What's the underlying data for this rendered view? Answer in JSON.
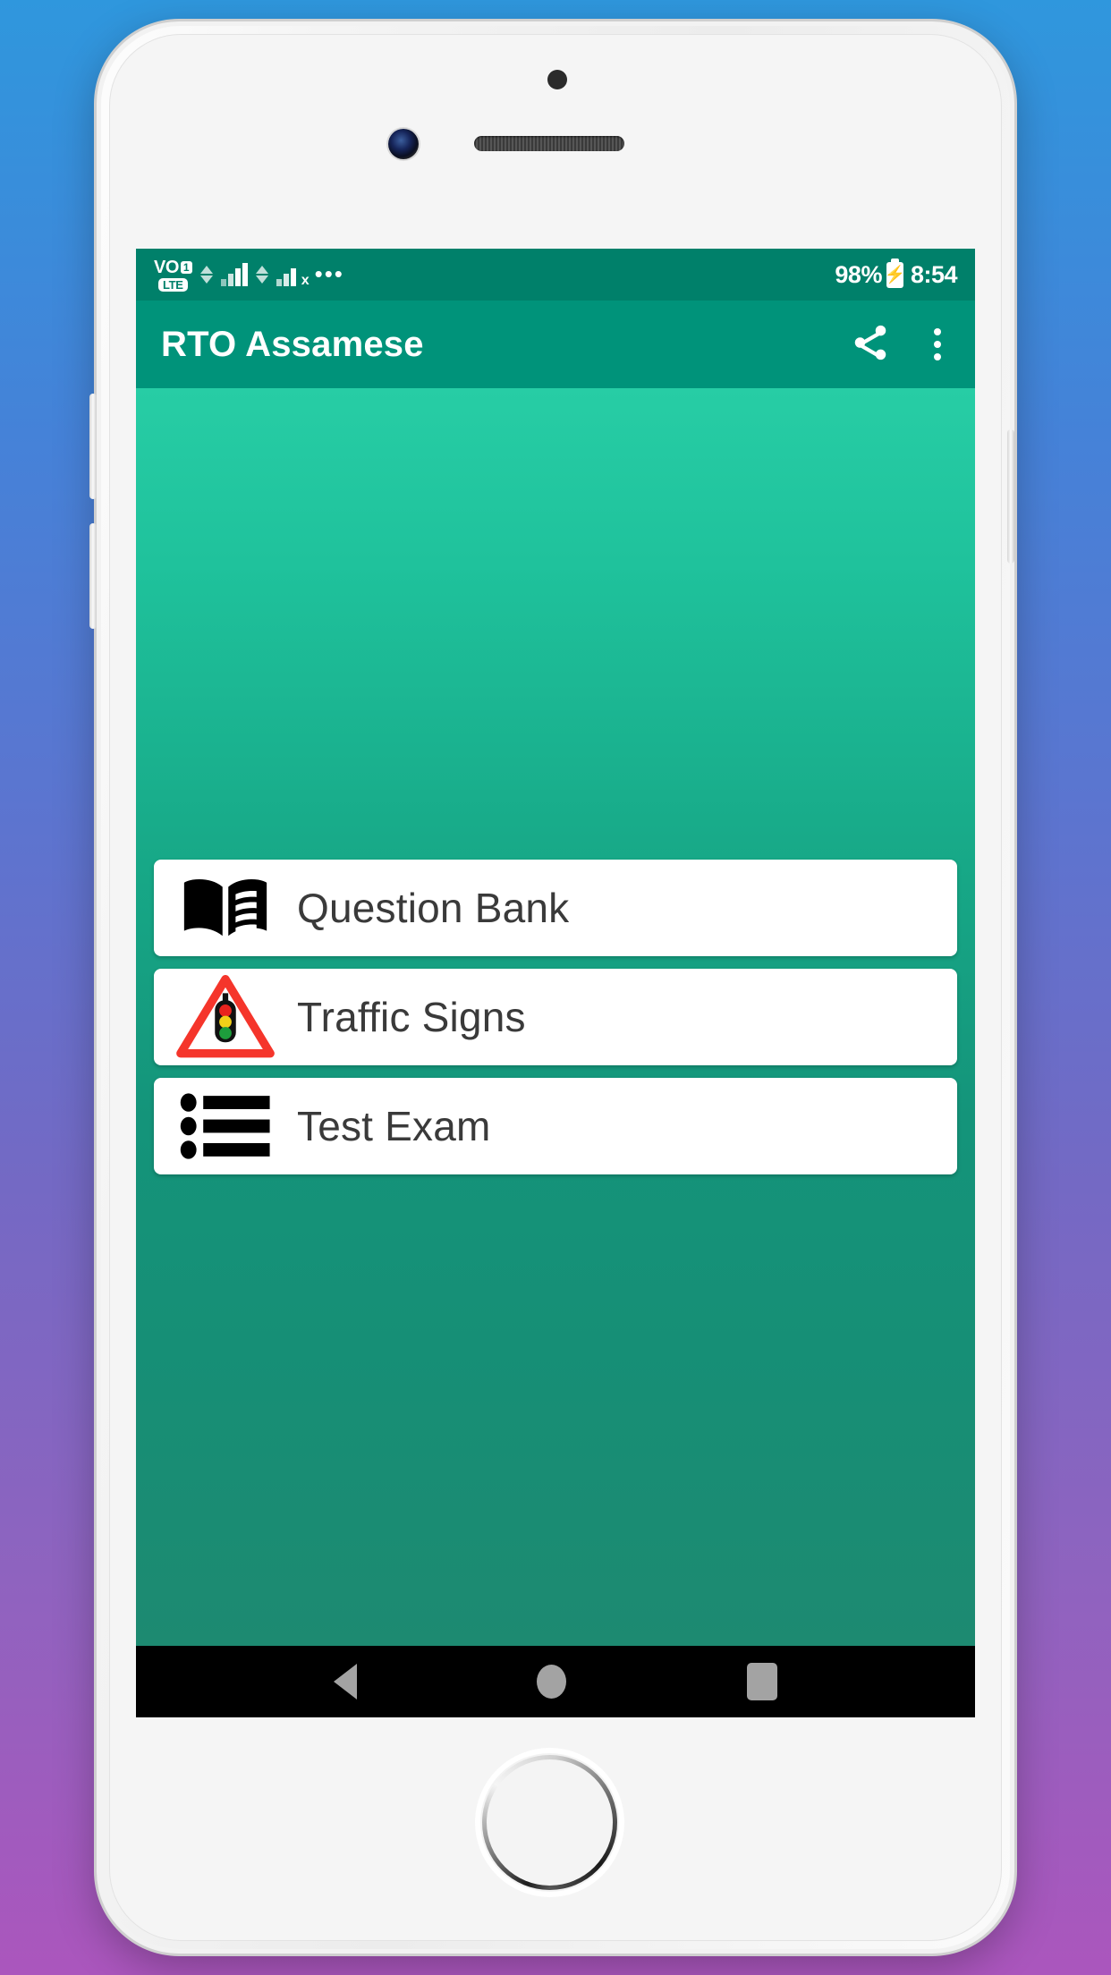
{
  "device": {
    "hardware": {
      "front_camera": "front-camera",
      "earpiece": "earpiece-speaker",
      "sensor": "proximity-sensor",
      "home_button": "home-button",
      "volume_up": "volume-up-button",
      "volume_down": "volume-down-button",
      "power": "power-button"
    }
  },
  "background": {
    "gradient_from": "#2f97dd",
    "gradient_to": "#ab56bd"
  },
  "status_bar": {
    "background": "#00806a",
    "volte": {
      "vo": "VO",
      "sim": "1",
      "lte": "LTE"
    },
    "icons": [
      "volte-icon",
      "data-transfer-icon",
      "signal-bars-icon",
      "data-transfer-icon-2",
      "signal-bars-no-service-icon",
      "more-notifications-icon"
    ],
    "signal_x_mark": "x",
    "more_dots": "•••",
    "battery_percent": "98%",
    "battery_state": "charging",
    "battery_bolt": "⚡",
    "time": "8:54"
  },
  "app_bar": {
    "background": "#00937a",
    "title": "RTO Assamese",
    "actions": [
      {
        "name": "share-icon",
        "label": "Share"
      },
      {
        "name": "overflow-menu-icon",
        "label": "More options"
      }
    ]
  },
  "content": {
    "gradient_from": "#27cda5",
    "gradient_to": "#1d8a71",
    "menu_items": [
      {
        "label": "Question Bank",
        "icon": "open-book-icon"
      },
      {
        "label": "Traffic Signs",
        "icon": "traffic-light-warning-sign-icon"
      },
      {
        "label": "Test Exam",
        "icon": "bulleted-list-icon"
      }
    ]
  },
  "nav_bar": {
    "background": "#000000",
    "buttons": [
      {
        "name": "nav-back-button",
        "label": "Back"
      },
      {
        "name": "nav-home-button",
        "label": "Home"
      },
      {
        "name": "nav-recents-button",
        "label": "Recents"
      }
    ]
  }
}
